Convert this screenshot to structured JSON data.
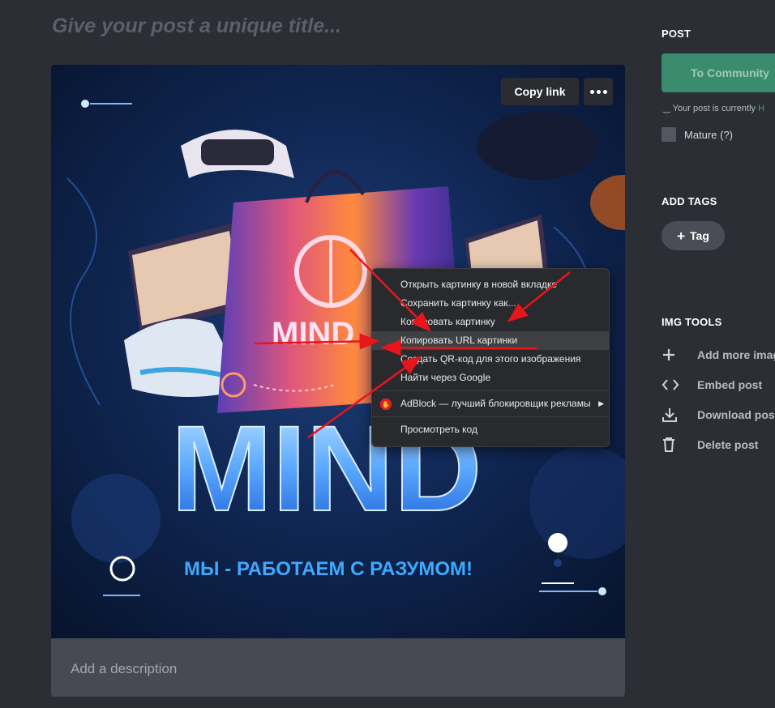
{
  "editor": {
    "title_placeholder": "Give your post a unique title...",
    "copy_link_label": "Copy link",
    "more_icon": "more-icon",
    "description_placeholder": "Add a description"
  },
  "image": {
    "headline": "MIND",
    "bag_text": "MIND",
    "slogan": "МЫ - РАБОТАЕМ С РАЗУМОМ!"
  },
  "context_menu": {
    "items": [
      "Открыть картинку в новой вкладке",
      "Сохранить картинку как...",
      "Копировать картинку",
      "Копировать URL картинки",
      "Создать QR-код для этого изображения",
      "Найти через Google"
    ],
    "adblock_label": "AdBlock — лучший блокировщик рекламы",
    "inspect_label": "Просмотреть код",
    "highlighted_index": 3
  },
  "sidebar": {
    "post_heading": "POST",
    "to_community_label": "To Community",
    "status_text": "Your post is currently",
    "status_highlight": "H",
    "mature_label": "Mature (?)",
    "tags_heading": "ADD TAGS",
    "tag_button_label": "Tag",
    "tools_heading": "IMG TOOLS",
    "tools": [
      {
        "label": "Add more imag",
        "icon": "plus-icon"
      },
      {
        "label": "Embed post",
        "icon": "code-icon"
      },
      {
        "label": "Download post",
        "icon": "download-icon"
      },
      {
        "label": "Delete post",
        "icon": "trash-icon"
      }
    ]
  },
  "colors": {
    "background": "#2b2e35",
    "accent_green": "#3b8c6e",
    "arrow_red": "#e8151b"
  }
}
